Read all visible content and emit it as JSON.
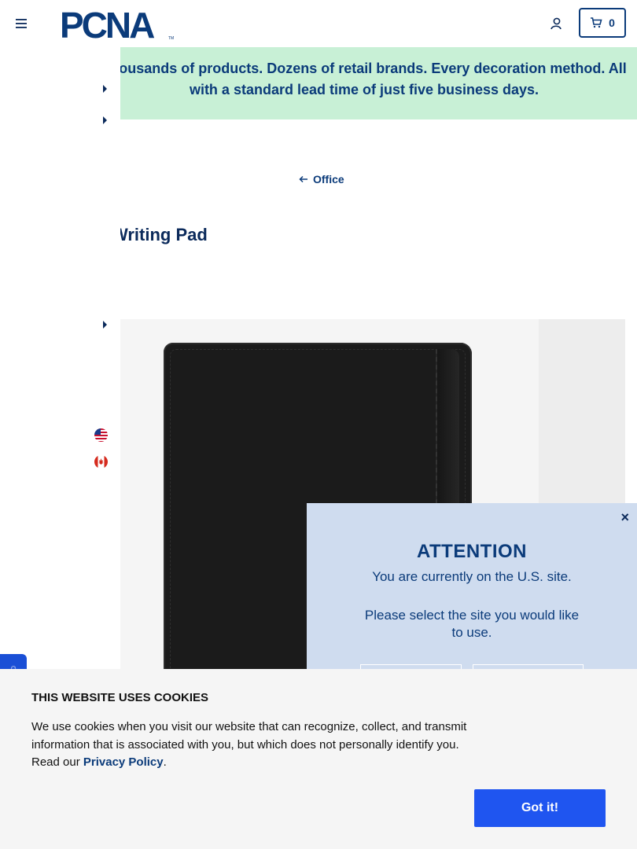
{
  "header": {
    "logo_text": "PCNA",
    "logo_tm": "TM",
    "cart_count": "0"
  },
  "banner": {
    "line1": "Thousands of products. Dozens of retail brands. Every decoration method. All",
    "line2": "with a standard lead time of just five business days."
  },
  "breadcrumb": {
    "back_label": "Office"
  },
  "product": {
    "title": "Writing Pad"
  },
  "site_modal": {
    "close_label": "×",
    "title": "ATTENTION",
    "current_site": "You are currently on the U.S. site.",
    "prompt": "Please select the site you would like to use."
  },
  "cookie_banner": {
    "title": "THIS WEBSITE USES COOKIES",
    "text_before_link": "We use cookies when you visit our website that can recognize, collect, and transmit information that is associated with you, but which does not personally identify you. Read our ",
    "link_label": "Privacy Policy",
    "text_after_link": ".",
    "accept_label": "Got it!"
  },
  "colors": {
    "brand_navy": "#0b3b7a",
    "banner_green": "#c8f0d6",
    "modal_bg": "#cfdcef",
    "accept_blue": "#1f55f0"
  }
}
